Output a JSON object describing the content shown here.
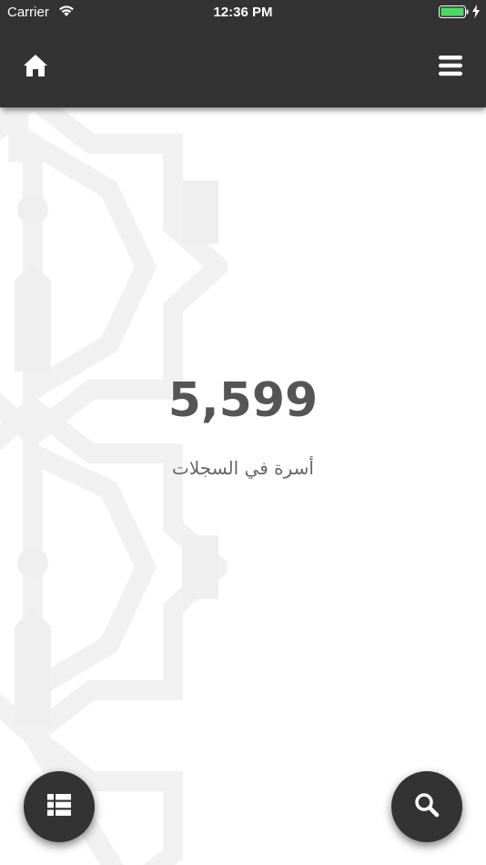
{
  "status_bar": {
    "carrier": "Carrier",
    "time": "12:36 PM"
  },
  "header": {
    "home_icon": "home-icon",
    "menu_icon": "hamburger-menu-icon",
    "background": "#333333"
  },
  "main": {
    "count": "5,599",
    "label": "أسرة في السجلات"
  },
  "actions": {
    "list_icon": "list-icon",
    "search_icon": "search-icon",
    "fab_color": "#333333"
  }
}
